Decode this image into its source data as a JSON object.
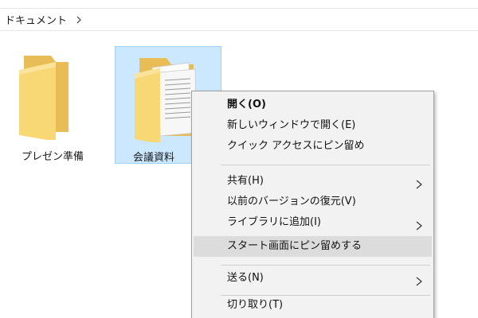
{
  "breadcrumb": {
    "path": "ドキュメント",
    "separator_icon": "chevron-right-icon"
  },
  "files": [
    {
      "name": "プレゼン準備",
      "icon": "folder-icon",
      "selected": false
    },
    {
      "name": "会議資料",
      "icon": "folder-with-documents-icon",
      "selected": true
    }
  ],
  "context_menu": {
    "items": [
      {
        "label": "開く(O)",
        "bold": true
      },
      {
        "label": "新しいウィンドウで開く(E)"
      },
      {
        "label": "クイック アクセスにピン留め"
      },
      {
        "label": "共有(H)",
        "submenu": true
      },
      {
        "label": "以前のバージョンの復元(V)"
      },
      {
        "label": "ライブラリに追加(I)",
        "submenu": true
      },
      {
        "label": "スタート画面にピン留めする",
        "highlighted": true
      },
      {
        "label": "送る(N)",
        "submenu": true
      },
      {
        "label": "切り取り(T)"
      }
    ]
  },
  "colors": {
    "selection_bg": "#cce8ff",
    "selection_border": "#99d1ff",
    "menu_bg": "#f2f2f2",
    "menu_highlight": "#dcdcdc",
    "folder": "#f8d775"
  }
}
